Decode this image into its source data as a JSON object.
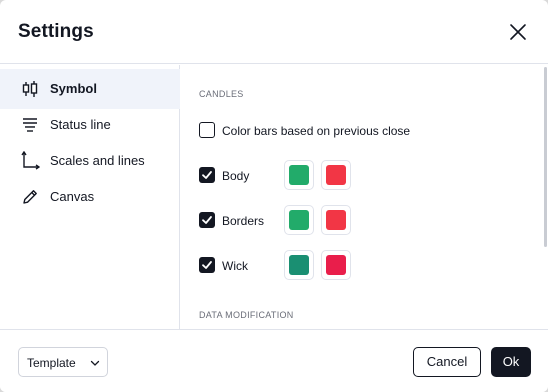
{
  "dialog": {
    "title": "Settings",
    "close_icon": "close-icon"
  },
  "sidebar": {
    "items": [
      {
        "label": "Symbol",
        "icon": "candlestick-icon",
        "active": true
      },
      {
        "label": "Status line",
        "icon": "status-line-icon",
        "active": false
      },
      {
        "label": "Scales and lines",
        "icon": "scales-icon",
        "active": false
      },
      {
        "label": "Canvas",
        "icon": "pencil-icon",
        "active": false
      }
    ]
  },
  "content": {
    "candles_section": "CANDLES",
    "color_bars_option": {
      "label": "Color bars based on previous close",
      "checked": false
    },
    "rows": [
      {
        "label": "Body",
        "checked": true,
        "up_color": "#22ab6a",
        "down_color": "#f23645"
      },
      {
        "label": "Borders",
        "checked": true,
        "up_color": "#22ab6a",
        "down_color": "#f23645"
      },
      {
        "label": "Wick",
        "checked": true,
        "up_color": "#1a8f72",
        "down_color": "#e91e4b"
      }
    ],
    "data_modification_section": "DATA MODIFICATION"
  },
  "footer": {
    "template_label": "Template",
    "cancel_label": "Cancel",
    "ok_label": "Ok"
  },
  "colors": {
    "accent_dark": "#131722",
    "active_nav_bg": "#f0f3fa",
    "divider": "#e0e3eb"
  }
}
